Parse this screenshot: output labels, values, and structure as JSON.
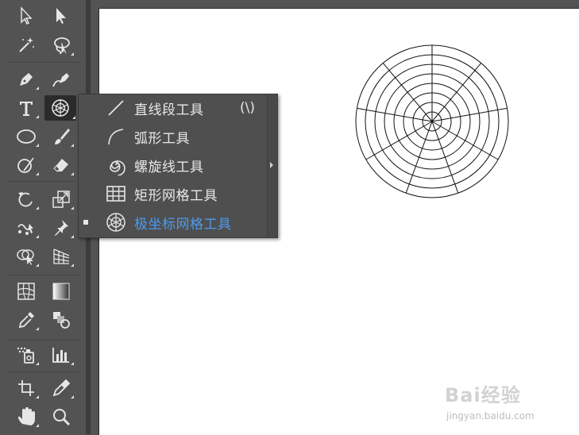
{
  "toolbar": {
    "tools": [
      {
        "name": "selection-tool-icon"
      },
      {
        "name": "direct-selection-tool-icon"
      },
      {
        "name": "magic-wand-tool-icon"
      },
      {
        "name": "lasso-tool-icon"
      },
      {
        "name": "pen-tool-icon"
      },
      {
        "name": "curvature-tool-icon"
      },
      {
        "name": "type-tool-icon"
      },
      {
        "name": "polar-grid-tool-icon"
      },
      {
        "name": "ellipse-tool-icon"
      },
      {
        "name": "paintbrush-tool-icon"
      },
      {
        "name": "shaper-tool-icon"
      },
      {
        "name": "eraser-tool-icon"
      },
      {
        "name": "rotate-tool-icon"
      },
      {
        "name": "scale-tool-icon"
      },
      {
        "name": "puppet-warp-tool-icon"
      },
      {
        "name": "pin-tool-icon"
      },
      {
        "name": "shape-builder-tool-icon"
      },
      {
        "name": "perspective-grid-tool-icon"
      },
      {
        "name": "mesh-tool-icon"
      },
      {
        "name": "gradient-tool-icon"
      },
      {
        "name": "eyedropper-tool-icon"
      },
      {
        "name": "blend-tool-icon"
      },
      {
        "name": "symbol-sprayer-tool-icon"
      },
      {
        "name": "column-graph-tool-icon"
      },
      {
        "name": "artboard-tool-icon"
      },
      {
        "name": "slice-tool-icon"
      },
      {
        "name": "hand-tool-icon"
      },
      {
        "name": "zoom-tool-icon"
      }
    ]
  },
  "flyout": {
    "items": [
      {
        "label": "直线段工具",
        "shortcut": "(\\)",
        "icon": "line-segment-icon",
        "selected": false
      },
      {
        "label": "弧形工具",
        "shortcut": "",
        "icon": "arc-icon",
        "selected": false
      },
      {
        "label": "螺旋线工具",
        "shortcut": "",
        "icon": "spiral-icon",
        "selected": false
      },
      {
        "label": "矩形网格工具",
        "shortcut": "",
        "icon": "rectangular-grid-icon",
        "selected": false
      },
      {
        "label": "极坐标网格工具",
        "shortcut": "",
        "icon": "polar-grid-icon",
        "selected": true
      }
    ]
  },
  "canvas": {
    "polar_grid": {
      "concentric_rings": 8,
      "radial_dividers": 9
    }
  },
  "watermark": {
    "brand": "Bai经验",
    "url": "jingyan.baidu.com"
  },
  "colors": {
    "ui_background": "#535353",
    "artboard": "#ffffff",
    "selected_text": "#4d9af0"
  }
}
